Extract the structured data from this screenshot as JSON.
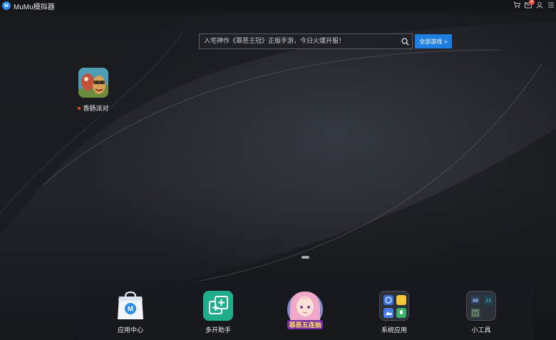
{
  "window": {
    "title": "MuMu模拟器",
    "logo_text": "M",
    "notification_count": "4"
  },
  "search": {
    "placeholder": "入宅神作《罪恶王冠》正版手游，今日火爆开服！",
    "all_games_label": "全部游戏 »"
  },
  "desktop": {
    "apps": [
      {
        "name": "香肠派对",
        "icon": "sausage-party-game-icon",
        "new_dot": true
      }
    ],
    "page_indicator": {
      "pages": 1,
      "current": 1
    }
  },
  "dock": {
    "items": [
      {
        "label": "应用中心",
        "icon": "app-center-bag-icon"
      },
      {
        "label": "多开助手",
        "icon": "multi-instance-icon"
      },
      {
        "label": "",
        "icon": "anime-game-promo-icon",
        "banner": "罪恶五连抽"
      },
      {
        "label": "系统应用",
        "icon": "system-apps-folder-icon"
      },
      {
        "label": "小工具",
        "icon": "tools-folder-icon"
      }
    ]
  },
  "colors": {
    "accent": "#1f7fe0",
    "background": "#1b1d22",
    "multi_instance_green": "#1fae8c",
    "badge_red": "#e94a3c"
  }
}
